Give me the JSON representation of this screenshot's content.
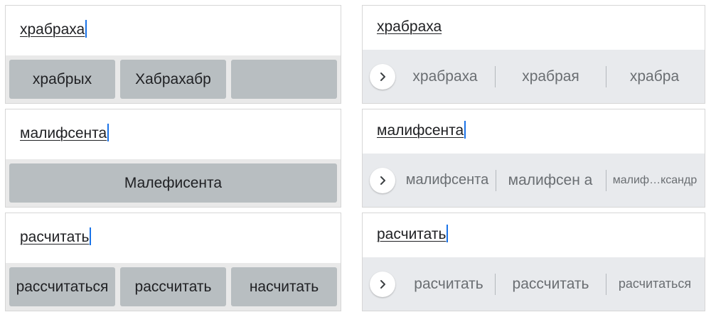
{
  "left": [
    {
      "word": "храбраха",
      "chips": [
        "храбрых",
        "Хабрахабр",
        ""
      ]
    },
    {
      "word": "малифсента",
      "chips": [
        "Малефисента"
      ]
    },
    {
      "word": "расчитать",
      "chips": [
        "рассчитаться",
        "рассчитать",
        "насчитать"
      ]
    }
  ],
  "right": [
    {
      "word": "храбраха",
      "suggestions": [
        "храбраха",
        "храбрая",
        "храбра"
      ]
    },
    {
      "word": "малифсента",
      "suggestions": [
        "малифсента",
        "малифсен а",
        "малиф…ксандр"
      ]
    },
    {
      "word": "расчитать",
      "suggestions": [
        "расчитать",
        "рассчитать",
        "расчитаться"
      ]
    }
  ],
  "colors": {
    "caret": "#1a73e8",
    "chip": "#b8bec1",
    "strip": "#e8eaed",
    "suggestion_text": "#6a6e72"
  },
  "icons": {
    "expand": "chevron-right-icon"
  }
}
